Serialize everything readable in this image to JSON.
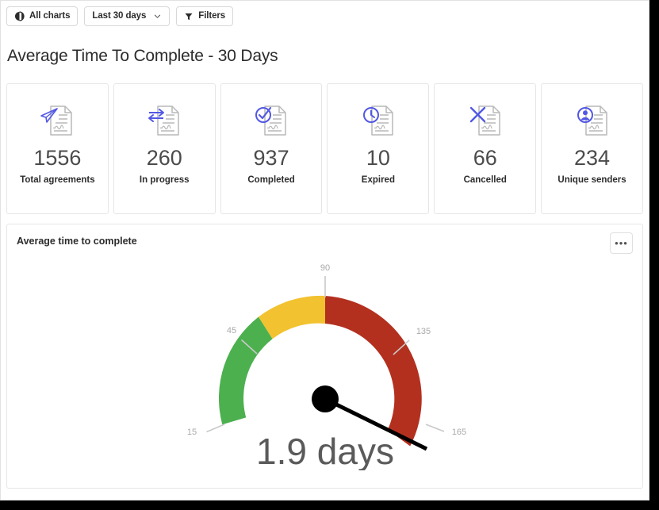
{
  "toolbar": {
    "all_charts": {
      "label": "All charts",
      "icon": "pie-chart-icon"
    },
    "date_range": {
      "label": "Last 30 days",
      "icon": "chevron-down-icon"
    },
    "filters": {
      "label": "Filters",
      "icon": "funnel-icon"
    }
  },
  "page": {
    "title": "Average Time To Complete - 30 Days"
  },
  "stats": [
    {
      "value": "1556",
      "label": "Total agreements",
      "icon": "document-send-icon"
    },
    {
      "value": "260",
      "label": "In progress",
      "icon": "document-exchange-icon"
    },
    {
      "value": "937",
      "label": "Completed",
      "icon": "document-check-icon"
    },
    {
      "value": "10",
      "label": "Expired",
      "icon": "document-clock-icon"
    },
    {
      "value": "66",
      "label": "Cancelled",
      "icon": "document-x-icon"
    },
    {
      "value": "234",
      "label": "Unique senders",
      "icon": "document-user-icon"
    }
  ],
  "chart_panel": {
    "title": "Average time to complete",
    "more_label": "•••"
  },
  "chart_data": {
    "type": "gauge",
    "title": "Average time to complete",
    "value": 1.9,
    "value_label": "1.9 days",
    "unit": "days",
    "axis_min": 0,
    "axis_max": 180,
    "tick_labels": [
      "15",
      "45",
      "90",
      "135",
      "165"
    ],
    "ticks": [
      15,
      45,
      90,
      135,
      165
    ],
    "bands": [
      {
        "name": "good",
        "from": 0,
        "to": 50,
        "color": "#4cb04f"
      },
      {
        "name": "warning",
        "from": 50,
        "to": 90,
        "color": "#f2c230"
      },
      {
        "name": "bad",
        "from": 90,
        "to": 180,
        "color": "#b3301f"
      }
    ],
    "needle_value": 177,
    "needle_color": "#000000",
    "value_text_color": "#5a5a5a",
    "tick_text_color": "#a9a9a9"
  },
  "colors": {
    "accent": "#5258e4",
    "green": "#4cb04f",
    "yellow": "#f2c230",
    "red": "#b3301f",
    "text": "#2c2c2c",
    "muted": "#a9a9a9",
    "border": "#e6e6e6"
  }
}
